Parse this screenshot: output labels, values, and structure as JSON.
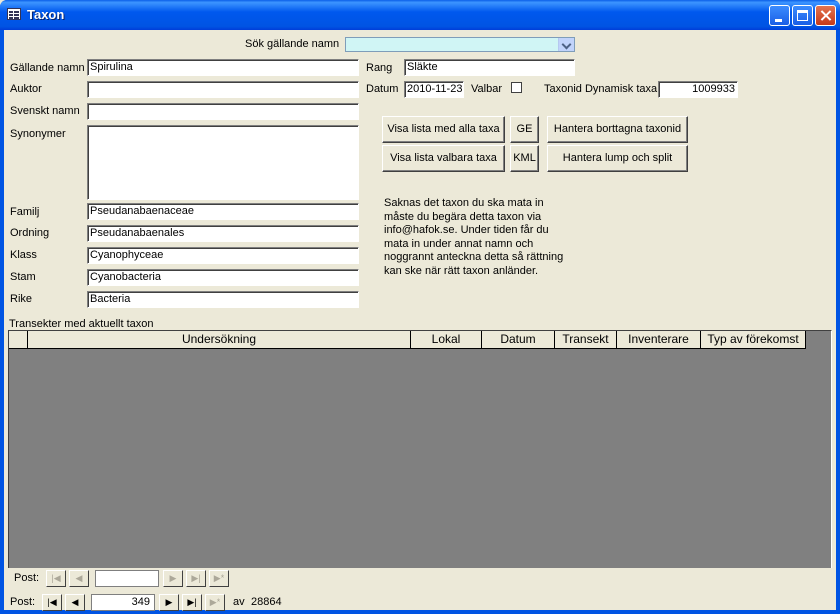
{
  "window": {
    "title": "Taxon"
  },
  "search": {
    "label": "Sök gällande namn",
    "value": ""
  },
  "fields": {
    "gallande_namn": {
      "label": "Gällande namn",
      "value": "Spirulina"
    },
    "auktor": {
      "label": "Auktor",
      "value": ""
    },
    "svenskt_namn": {
      "label": "Svenskt namn",
      "value": ""
    },
    "synonymer": {
      "label": "Synonymer",
      "value": ""
    },
    "familj": {
      "label": "Familj",
      "value": "Pseudanabaenaceae"
    },
    "ordning": {
      "label": "Ordning",
      "value": "Pseudanabaenales"
    },
    "klass": {
      "label": "Klass",
      "value": "Cyanophyceae"
    },
    "stam": {
      "label": "Stam",
      "value": "Cyanobacteria"
    },
    "rike": {
      "label": "Rike",
      "value": "Bacteria"
    },
    "rang": {
      "label": "Rang",
      "value": "Släkte"
    },
    "datum": {
      "label": "Datum",
      "value": "2010-11-23"
    },
    "valbar": {
      "label": "Valbar",
      "checked": false
    },
    "taxonid": {
      "label": "Taxonid Dynamisk taxa",
      "value": "1009933"
    }
  },
  "buttons": {
    "visa_alla": "Visa lista med alla taxa",
    "visa_valbara": "Visa lista valbara taxa",
    "ge": "GE",
    "kml": "KML",
    "hantera_borttagna": "Hantera borttagna taxonid",
    "hantera_lump": "Hantera lump och split"
  },
  "info_text": "Saknas det taxon du ska mata in\nmåste du begära detta taxon via\ninfo@hafok.se. Under tiden får du\nmata in under annat namn och\nnoggrannt anteckna detta så rättning\nkan ske när rätt taxon anländer.",
  "subform": {
    "label": "Transekter med aktuellt taxon",
    "columns": [
      "Undersökning",
      "Lokal",
      "Datum",
      "Transekt",
      "Inventerare",
      "Typ av förekomst"
    ],
    "nav": {
      "label": "Post:",
      "record": ""
    }
  },
  "main_nav": {
    "label": "Post:",
    "record": "349",
    "of_label": "av",
    "total": "28864"
  }
}
